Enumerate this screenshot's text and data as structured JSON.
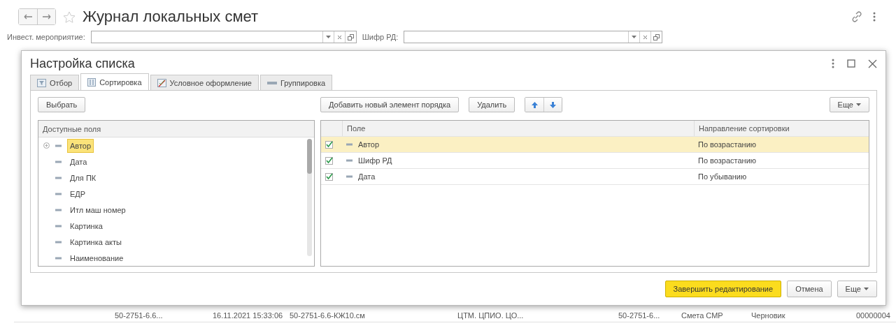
{
  "window": {
    "title": "Журнал локальных смет"
  },
  "filters": [
    {
      "label": "Инвест. мероприятие:"
    },
    {
      "label": "Шифр РД:"
    }
  ],
  "background_row": {
    "cells": [
      "50-2751-6.6...",
      "16.11.2021 15:33:06",
      "50-2751-6.6-КЖ10.см",
      "ЦТМ. ЦПИО. ЦО...",
      "50-2751-6...",
      "Смета СМР",
      "Черновик",
      "00000004"
    ]
  },
  "dialog": {
    "title": "Настройка списка",
    "tabs": [
      {
        "label": "Отбор",
        "selected": false
      },
      {
        "label": "Сортировка",
        "selected": true
      },
      {
        "label": "Условное оформление",
        "selected": false
      },
      {
        "label": "Группировка",
        "selected": false
      }
    ],
    "left": {
      "button": "Выбрать",
      "header": "Доступные поля",
      "fields": [
        {
          "label": "Автор",
          "expandable": true,
          "selected": true
        },
        {
          "label": "Дата",
          "expandable": false,
          "selected": false
        },
        {
          "label": "Для ПК",
          "expandable": false,
          "selected": false
        },
        {
          "label": "ЕДР",
          "expandable": false,
          "selected": false
        },
        {
          "label": "Итл маш номер",
          "expandable": false,
          "selected": false
        },
        {
          "label": "Картинка",
          "expandable": false,
          "selected": false
        },
        {
          "label": "Картинка акты",
          "expandable": false,
          "selected": false
        },
        {
          "label": "Наименование",
          "expandable": false,
          "selected": false
        }
      ]
    },
    "right": {
      "buttons": [
        "Добавить новый элемент порядка",
        "Удалить"
      ],
      "more": "Еще",
      "columns": [
        "Поле",
        "Направление сортировки"
      ],
      "rows": [
        {
          "field": "Автор",
          "direction": "По возрастанию",
          "checked": true,
          "selected": true
        },
        {
          "field": "Шифр РД",
          "direction": "По возрастанию",
          "checked": true,
          "selected": false
        },
        {
          "field": "Дата",
          "direction": "По убыванию",
          "checked": true,
          "selected": false
        }
      ]
    },
    "footer": {
      "primary": "Завершить редактирование",
      "cancel": "Отмена",
      "more": "Еще"
    }
  }
}
